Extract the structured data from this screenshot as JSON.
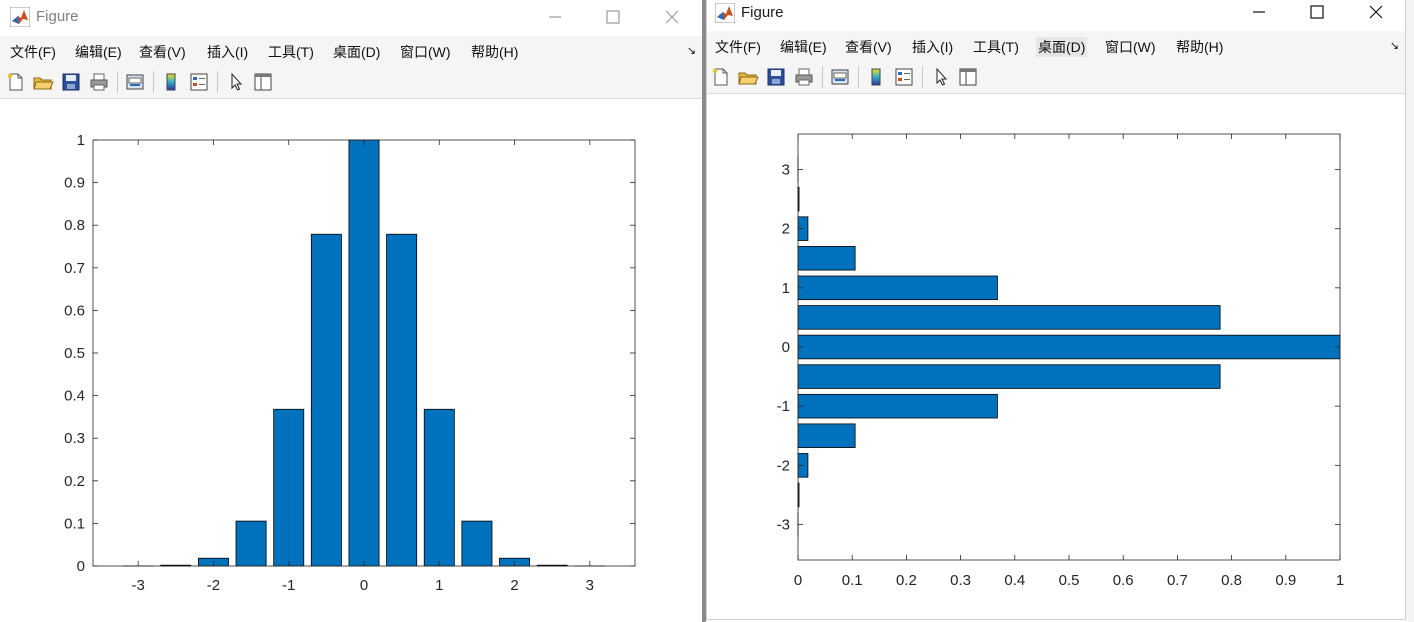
{
  "windows": [
    {
      "title": "Figure",
      "menu": [
        "文件(F)",
        "编辑(E)",
        "查看(V)",
        "插入(I)",
        "工具(T)",
        "桌面(D)",
        "窗口(W)",
        "帮助(H)"
      ],
      "toolbar_icons": [
        "new-figure-icon",
        "open-file-icon",
        "save-icon",
        "print-icon",
        "link-plot-icon",
        "colorbar-icon",
        "legend-icon",
        "pointer-icon",
        "property-editor-icon"
      ]
    },
    {
      "title": "Figure",
      "menu": [
        "文件(F)",
        "编辑(E)",
        "查看(V)",
        "插入(I)",
        "工具(T)",
        "桌面(D)",
        "窗口(W)",
        "帮助(H)"
      ],
      "toolbar_icons": [
        "new-figure-icon",
        "open-file-icon",
        "save-icon",
        "print-icon",
        "link-plot-icon",
        "colorbar-icon",
        "legend-icon",
        "pointer-icon",
        "property-editor-icon"
      ]
    }
  ],
  "chart_data": [
    {
      "type": "bar",
      "orientation": "vertical",
      "x": [
        -3,
        -2.5,
        -2,
        -1.5,
        -1,
        -0.5,
        0,
        0.5,
        1,
        1.5,
        2,
        2.5,
        3
      ],
      "values": [
        0.0001,
        0.0019,
        0.0183,
        0.1054,
        0.3679,
        0.7788,
        1,
        0.7788,
        0.3679,
        0.1054,
        0.0183,
        0.0019,
        0.0001
      ],
      "xlim": [
        -3.6,
        3.6
      ],
      "ylim": [
        0,
        1
      ],
      "xticks": [
        "-3",
        "-2",
        "-1",
        "0",
        "1",
        "2",
        "3"
      ],
      "yticks": [
        "0",
        "0.1",
        "0.2",
        "0.3",
        "0.4",
        "0.5",
        "0.6",
        "0.7",
        "0.8",
        "0.9",
        "1"
      ],
      "bar_color": "#0072BD"
    },
    {
      "type": "bar",
      "orientation": "horizontal",
      "y": [
        -3,
        -2.5,
        -2,
        -1.5,
        -1,
        -0.5,
        0,
        0.5,
        1,
        1.5,
        2,
        2.5,
        3
      ],
      "values": [
        0.0001,
        0.0019,
        0.0183,
        0.1054,
        0.3679,
        0.7788,
        1,
        0.7788,
        0.3679,
        0.1054,
        0.0183,
        0.0019,
        0.0001
      ],
      "xlim": [
        0,
        1
      ],
      "ylim": [
        -3.6,
        3.6
      ],
      "xticks": [
        "0",
        "0.1",
        "0.2",
        "0.3",
        "0.4",
        "0.5",
        "0.6",
        "0.7",
        "0.8",
        "0.9",
        "1"
      ],
      "yticks": [
        "-3",
        "-2",
        "-1",
        "0",
        "1",
        "2",
        "3"
      ],
      "bar_color": "#0072BD"
    }
  ]
}
